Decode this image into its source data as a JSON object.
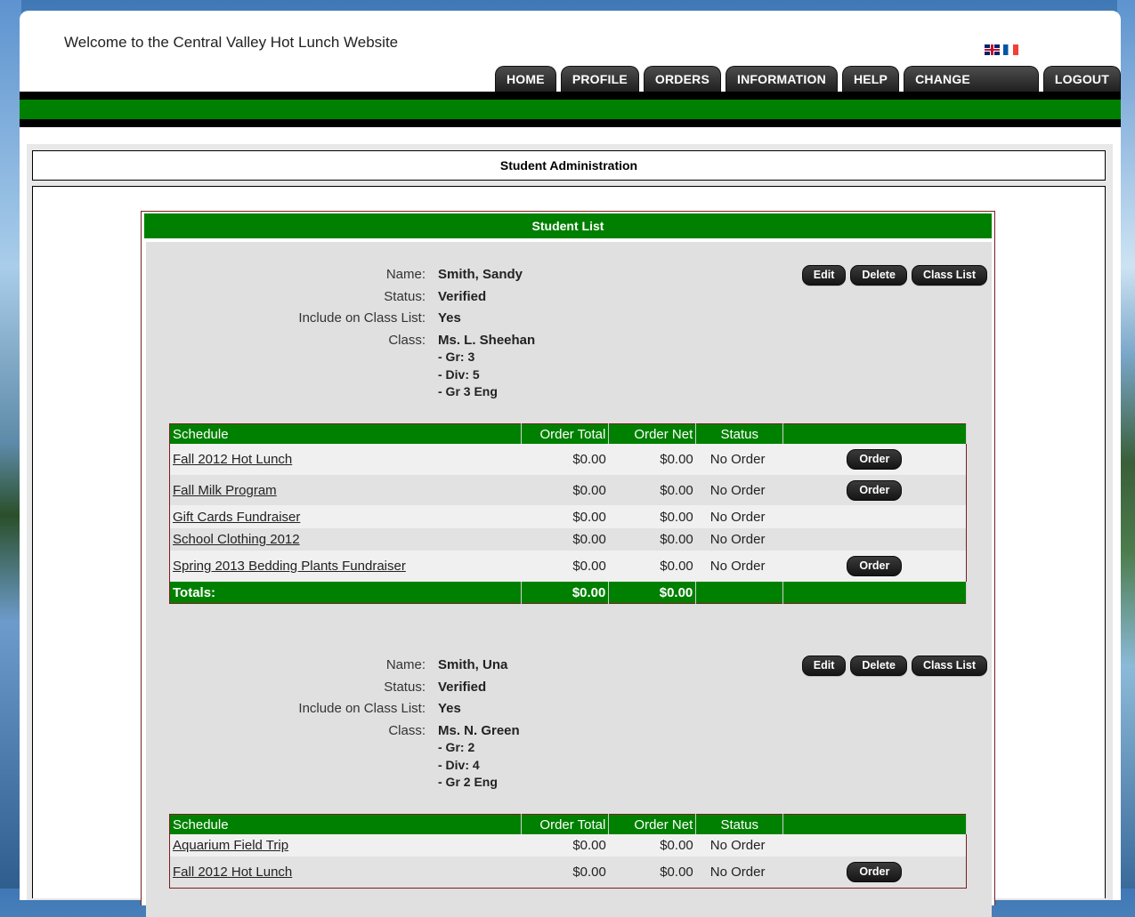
{
  "header": {
    "welcome": "Welcome to the Central Valley Hot Lunch Website",
    "flags": [
      "english-flag-icon",
      "french-flag-icon"
    ]
  },
  "nav": {
    "tabs": [
      {
        "label": "HOME"
      },
      {
        "label": "PROFILE"
      },
      {
        "label": "ORDERS"
      },
      {
        "label": "INFORMATION"
      },
      {
        "label": "HELP"
      },
      {
        "label": "CHANGE PASSWORD"
      },
      {
        "label": "LOGOUT"
      }
    ]
  },
  "page": {
    "section_title": "Student Administration",
    "list_title": "Student List"
  },
  "labels": {
    "name": "Name:",
    "status": "Status:",
    "include": "Include on Class List:",
    "class": "Class:",
    "edit": "Edit",
    "delete": "Delete",
    "class_list": "Class List",
    "order": "Order"
  },
  "table_headers": {
    "schedule": "Schedule",
    "order_total": "Order Total",
    "order_net": "Order Net",
    "status": "Status",
    "totals": "Totals:"
  },
  "students": [
    {
      "name": "Smith, Sandy",
      "status": "Verified",
      "include": "Yes",
      "class_teacher": "Ms. L. Sheehan",
      "class_grade": "- Gr: 3",
      "class_div": "- Div: 5",
      "class_prog": "- Gr 3 Eng",
      "rows": [
        {
          "schedule": "Fall 2012 Hot Lunch",
          "total": "$0.00",
          "net": "$0.00",
          "status": "No Order",
          "order": true
        },
        {
          "schedule": "Fall Milk Program",
          "total": "$0.00",
          "net": "$0.00",
          "status": "No Order",
          "order": true
        },
        {
          "schedule": "Gift Cards Fundraiser",
          "total": "$0.00",
          "net": "$0.00",
          "status": "No Order",
          "order": false
        },
        {
          "schedule": "School Clothing 2012",
          "total": "$0.00",
          "net": "$0.00",
          "status": "No Order",
          "order": false
        },
        {
          "schedule": "Spring 2013 Bedding Plants Fundraiser",
          "total": "$0.00",
          "net": "$0.00",
          "status": "No Order",
          "order": true
        }
      ],
      "totals_total": "$0.00",
      "totals_net": "$0.00"
    },
    {
      "name": "Smith, Una",
      "status": "Verified",
      "include": "Yes",
      "class_teacher": "Ms. N. Green",
      "class_grade": "- Gr: 2",
      "class_div": "- Div: 4",
      "class_prog": "- Gr 2 Eng",
      "rows": [
        {
          "schedule": "Aquarium Field Trip",
          "total": "$0.00",
          "net": "$0.00",
          "status": "No Order",
          "order": false
        },
        {
          "schedule": "Fall 2012 Hot Lunch",
          "total": "$0.00",
          "net": "$0.00",
          "status": "No Order",
          "order": true
        }
      ]
    }
  ]
}
